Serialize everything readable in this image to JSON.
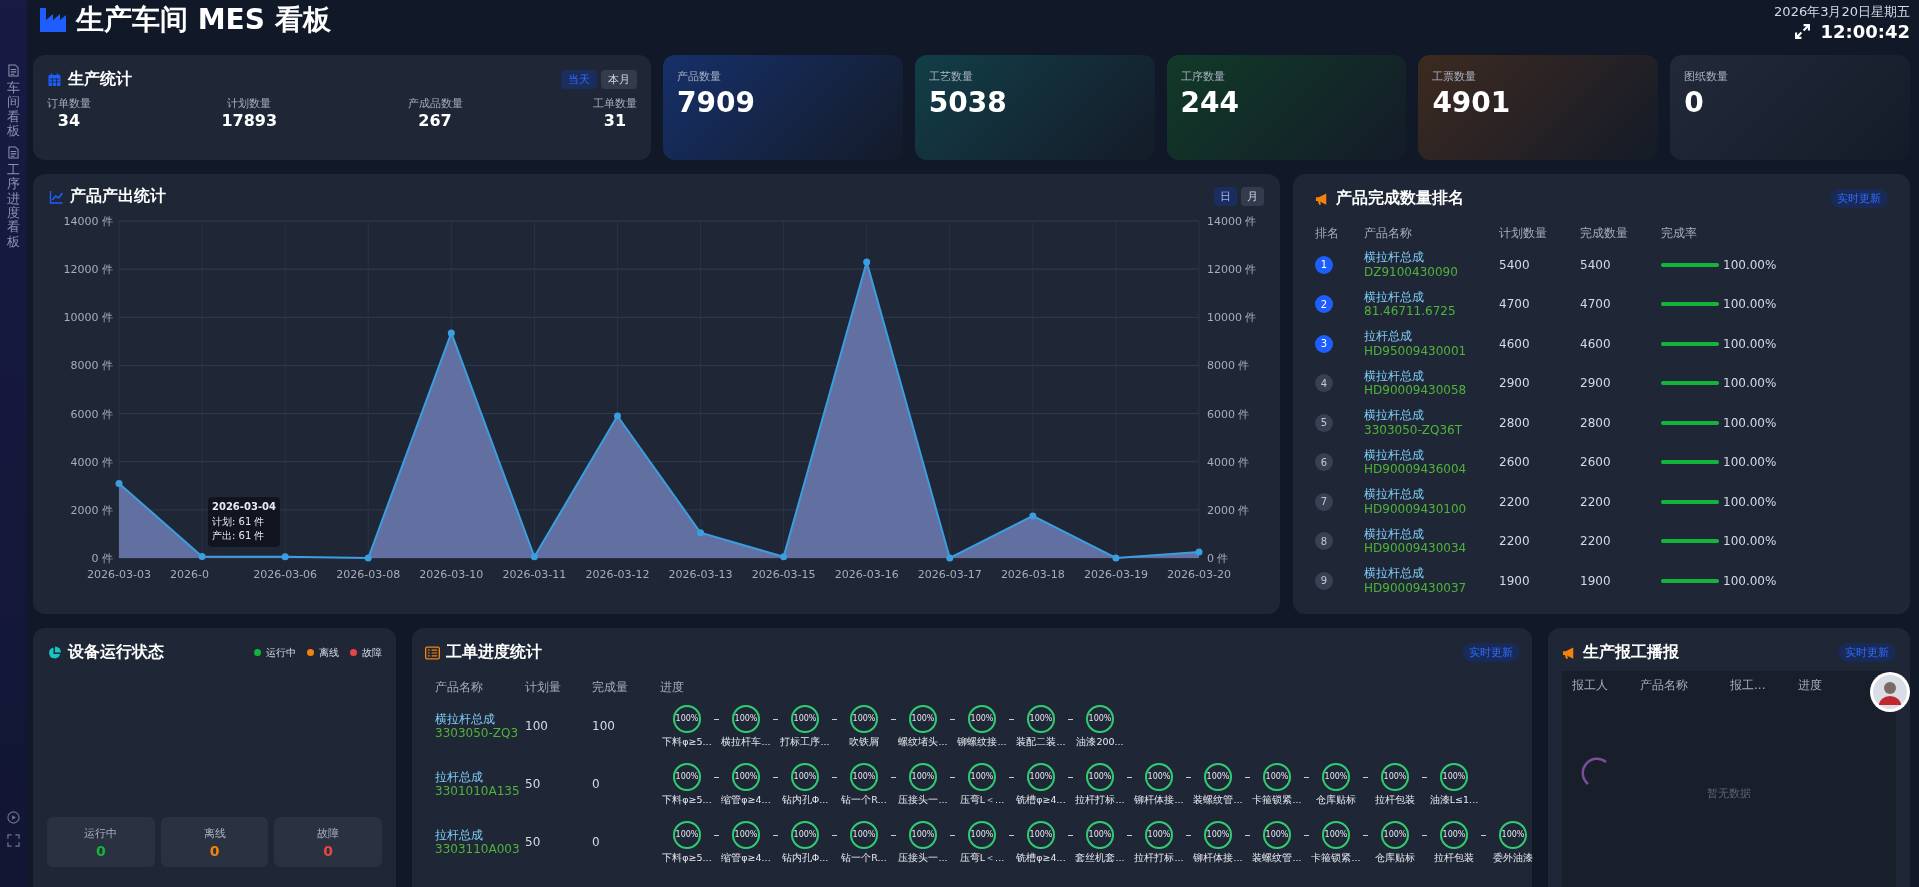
{
  "sidebar": {
    "items": [
      {
        "label": "车间看板"
      },
      {
        "label": "工序进度看板"
      }
    ]
  },
  "header": {
    "title": "生产车间 MES 看板",
    "date": "2026年3月20日星期五",
    "time": "12:00:42"
  },
  "production_stats": {
    "title": "生产统计",
    "ranges": [
      {
        "label": "当天",
        "selected": true
      },
      {
        "label": "本月",
        "selected": false
      }
    ],
    "metrics": [
      {
        "label": "订单数量",
        "value": "34"
      },
      {
        "label": "计划数量",
        "value": "17893"
      },
      {
        "label": "产成品数量",
        "value": "267"
      },
      {
        "label": "工单数量",
        "value": "31"
      }
    ]
  },
  "summary_cards": [
    {
      "label": "产品数量",
      "value": "7909",
      "color": "#16306a"
    },
    {
      "label": "工艺数量",
      "value": "5038",
      "color": "#123e48"
    },
    {
      "label": "工序数量",
      "value": "244",
      "color": "#113a28"
    },
    {
      "label": "工票数量",
      "value": "4901",
      "color": "#3d2a20"
    },
    {
      "label": "图纸数量",
      "value": "0",
      "color": "#222a3a"
    }
  ],
  "output_chart": {
    "title": "产品产出统计",
    "periods": [
      {
        "label": "日",
        "selected": true
      },
      {
        "label": "月",
        "selected": false
      }
    ],
    "tooltip": {
      "date": "2026-03-04",
      "lines": [
        "计划: 61 件",
        "产出: 61 件"
      ]
    },
    "chart_data": {
      "type": "area",
      "categories": [
        "2026-03-03",
        "2026-0",
        "2026-03-06",
        "2026-03-08",
        "2026-03-10",
        "2026-03-11",
        "2026-03-12",
        "2026-03-13",
        "2026-03-15",
        "2026-03-16",
        "2026-03-17",
        "2026-03-18",
        "2026-03-19",
        "2026-03-20"
      ],
      "series": [
        {
          "color": "#3a9ee0",
          "values": [
            3100,
            60,
            50,
            0,
            9350,
            50,
            5900,
            1050,
            50,
            12300,
            0,
            1750,
            0,
            250
          ]
        }
      ],
      "ylim": [
        0,
        14000
      ],
      "grid": true,
      "yticks": [
        {
          "value": 0,
          "label": "0 件"
        },
        {
          "value": 2000,
          "label": "2000 件"
        },
        {
          "value": 4000,
          "label": "4000 件"
        },
        {
          "value": 6000,
          "label": "6000 件"
        },
        {
          "value": 8000,
          "label": "8000 件"
        },
        {
          "value": 10000,
          "label": "10000 件"
        },
        {
          "value": 12000,
          "label": "12000 件"
        },
        {
          "value": 14000,
          "label": "14000 件"
        }
      ]
    }
  },
  "ranking": {
    "title": "产品完成数量排名",
    "badge": "实时更新",
    "columns": [
      "排名",
      "产品名称",
      "计划数量",
      "完成数量",
      "完成率"
    ],
    "rows": [
      {
        "rank": "1",
        "highlighted": true,
        "name": "横拉杆总成",
        "code": "DZ9100430090",
        "planned": "5400",
        "completed": "5400",
        "level": 1,
        "rate": "100.00%"
      },
      {
        "rank": "2",
        "highlighted": true,
        "name": "横拉杆总成",
        "code": "81.46711.6725",
        "planned": "4700",
        "completed": "4700",
        "level": 1,
        "rate": "100.00%"
      },
      {
        "rank": "3",
        "highlighted": true,
        "name": "拉杆总成",
        "code": "HD95009430001",
        "planned": "4600",
        "completed": "4600",
        "level": 1,
        "rate": "100.00%"
      },
      {
        "rank": "4",
        "highlighted": false,
        "name": "横拉杆总成",
        "code": "HD90009430058",
        "planned": "2900",
        "completed": "2900",
        "level": 1,
        "rate": "100.00%"
      },
      {
        "rank": "5",
        "highlighted": false,
        "name": "横拉杆总成",
        "code": "3303050-ZQ36T",
        "planned": "2800",
        "completed": "2800",
        "level": 1,
        "rate": "100.00%"
      },
      {
        "rank": "6",
        "highlighted": false,
        "name": "横拉杆总成",
        "code": "HD90009436004",
        "planned": "2600",
        "completed": "2600",
        "level": 1,
        "rate": "100.00%"
      },
      {
        "rank": "7",
        "highlighted": false,
        "name": "横拉杆总成",
        "code": "HD90009430100",
        "planned": "2200",
        "completed": "2200",
        "level": 1,
        "rate": "100.00%"
      },
      {
        "rank": "8",
        "highlighted": false,
        "name": "横拉杆总成",
        "code": "HD90009430034",
        "planned": "2200",
        "completed": "2200",
        "level": 1,
        "rate": "100.00%"
      },
      {
        "rank": "9",
        "highlighted": false,
        "name": "横拉杆总成",
        "code": "HD90009430037",
        "planned": "1900",
        "completed": "1900",
        "level": 1,
        "rate": "100.00%"
      }
    ]
  },
  "device_status": {
    "title": "设备运行状态",
    "legend": [
      {
        "label": "运行中",
        "color": "#16b33c"
      },
      {
        "label": "离线",
        "color": "#f5820b"
      },
      {
        "label": "故障",
        "color": "#e84545"
      }
    ],
    "stats": [
      {
        "label": "运行中",
        "value": "0",
        "color": "#16b33c"
      },
      {
        "label": "离线",
        "value": "0",
        "color": "#f5820b"
      },
      {
        "label": "故障",
        "value": "0",
        "color": "#e84545"
      }
    ]
  },
  "work_orders": {
    "title": "工单进度统计",
    "badge": "实时更新",
    "columns": [
      "产品名称",
      "计划量",
      "完成量",
      "进度"
    ],
    "rows": [
      {
        "name": "横拉杆总成",
        "code": "3303050-ZQ3",
        "planned": "100",
        "completed": "100",
        "steps": [
          {
            "percent": "100%",
            "level": 1,
            "label": "下料φ≥5..."
          },
          {
            "percent": "100%",
            "level": 1,
            "label": "横拉杆车..."
          },
          {
            "percent": "100%",
            "level": 1,
            "label": "打标工序..."
          },
          {
            "percent": "100%",
            "level": 1,
            "label": "吹铁屑"
          },
          {
            "percent": "100%",
            "level": 1,
            "label": "螺纹堵头..."
          },
          {
            "percent": "100%",
            "level": 1,
            "label": "铆螺纹接..."
          },
          {
            "percent": "100%",
            "level": 1,
            "label": "装配二装..."
          },
          {
            "percent": "100%",
            "level": 1,
            "label": "油漆200..."
          }
        ]
      },
      {
        "name": "拉杆总成",
        "code": "3301010A135",
        "planned": "50",
        "completed": "0",
        "steps": [
          {
            "percent": "100%",
            "level": 1,
            "label": "下料φ≥5..."
          },
          {
            "percent": "100%",
            "level": 1,
            "label": "缩管φ≥4..."
          },
          {
            "percent": "100%",
            "level": 1,
            "label": "钻内孔Φ..."
          },
          {
            "percent": "100%",
            "level": 1,
            "label": "钻一个R..."
          },
          {
            "percent": "100%",
            "level": 1,
            "label": "压接头一..."
          },
          {
            "percent": "100%",
            "level": 1,
            "label": "压弯L＜..."
          },
          {
            "percent": "100%",
            "level": 1,
            "label": "铣槽φ≥4..."
          },
          {
            "percent": "100%",
            "level": 1,
            "label": "拉杆打标..."
          },
          {
            "percent": "100%",
            "level": 1,
            "label": "铆杆体接..."
          },
          {
            "percent": "100%",
            "level": 1,
            "label": "装螺纹管..."
          },
          {
            "percent": "100%",
            "level": 1,
            "label": "卡箍锁紧..."
          },
          {
            "percent": "100%",
            "level": 1,
            "label": "仓库贴标"
          },
          {
            "percent": "100%",
            "level": 1,
            "label": "拉杆包装"
          },
          {
            "percent": "100%",
            "level": 1,
            "label": "油漆L≤1..."
          }
        ]
      },
      {
        "name": "拉杆总成",
        "code": "3303110A003",
        "planned": "50",
        "completed": "0",
        "steps": [
          {
            "percent": "100%",
            "level": 1,
            "label": "下料φ≥5..."
          },
          {
            "percent": "100%",
            "level": 1,
            "label": "缩管φ≥4..."
          },
          {
            "percent": "100%",
            "level": 1,
            "label": "钻内孔Φ..."
          },
          {
            "percent": "100%",
            "level": 1,
            "label": "钻一个R..."
          },
          {
            "percent": "100%",
            "level": 1,
            "label": "压接头一..."
          },
          {
            "percent": "100%",
            "level": 1,
            "label": "压弯L＜..."
          },
          {
            "percent": "100%",
            "level": 1,
            "label": "铣槽φ≥4..."
          },
          {
            "percent": "100%",
            "level": 1,
            "label": "套丝机套..."
          },
          {
            "percent": "100%",
            "level": 1,
            "label": "拉杆打标..."
          },
          {
            "percent": "100%",
            "level": 1,
            "label": "铆杆体接..."
          },
          {
            "percent": "100%",
            "level": 1,
            "label": "装螺纹管..."
          },
          {
            "percent": "100%",
            "level": 1,
            "label": "卡箍锁紧..."
          },
          {
            "percent": "100%",
            "level": 1,
            "label": "仓库贴标"
          },
          {
            "percent": "100%",
            "level": 1,
            "label": "拉杆包装"
          },
          {
            "percent": "100%",
            "level": 1,
            "label": "委外油漆"
          }
        ]
      }
    ]
  },
  "report": {
    "title": "生产报工播报",
    "badge": "实时更新",
    "columns": [
      "报工人",
      "产品名称",
      "报工...",
      "进度"
    ],
    "empty": "暂无数据"
  }
}
